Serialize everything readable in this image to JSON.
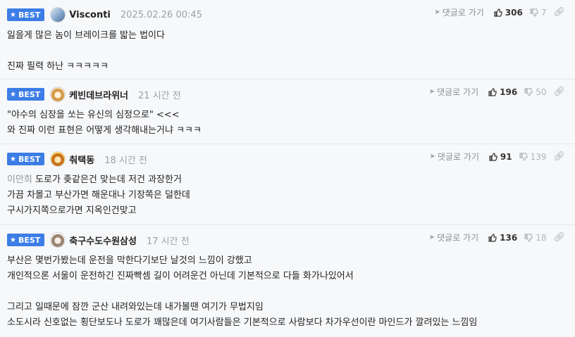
{
  "comments": [
    {
      "badge": "BEST",
      "nick": "Visconti",
      "time": "2025.02.26 00:45",
      "reply_label": "댓글로 가기",
      "up": "306",
      "down": "7",
      "lines": [
        "잃을게 많은 놈이 브레이크를 밟는 법이다",
        "",
        "진짜 필력 하난 ㅋㅋㅋㅋㅋ"
      ]
    },
    {
      "badge": "BEST",
      "nick": "케빈데브라위너",
      "time": "21 시간 전",
      "reply_label": "댓글로 가기",
      "up": "196",
      "down": "50",
      "lines": [
        "\"야수의 심장을 쏘는 유신의 심정으로\" <<<",
        "와 진짜 이런 표현은 어떻게 생각해내는거냐 ㅋㅋㅋ"
      ]
    },
    {
      "badge": "BEST",
      "nick": "춰택동",
      "time": "18 시간 전",
      "reply_label": "댓글로 가기",
      "up": "91",
      "down": "139",
      "mention": "이만희",
      "lines": [
        "도로가 좆같은건 맞는데 저건 과장한거",
        "가끔 차몰고 부산가면 해운대나 기장쪽은 덜한데",
        "구시가지쪽으로가면 지옥인건맞고"
      ]
    },
    {
      "badge": "BEST",
      "nick": "축구수도수원삼성",
      "time": "17 시간 전",
      "reply_label": "댓글로 가기",
      "up": "136",
      "down": "18",
      "lines": [
        "부산은 몇번가봤는데 운전을 막한다기보단 날것의 느낌이 강했고",
        "개인적으론 서울이 운전하긴 진짜빡셈 길이 어려운건 아닌데 기본적으로 다들 화가나있어서",
        "",
        "그리고 일때문에 잠깐 군산 내려와있는데 내가볼땐 여기가 무법지임",
        "소도시라 신호없는 횡단보도나 도로가 꽤많은데 여기사람들은 기본적으로 사람보다 차가우선이란 마인드가 깔려있는 느낌임"
      ]
    }
  ]
}
